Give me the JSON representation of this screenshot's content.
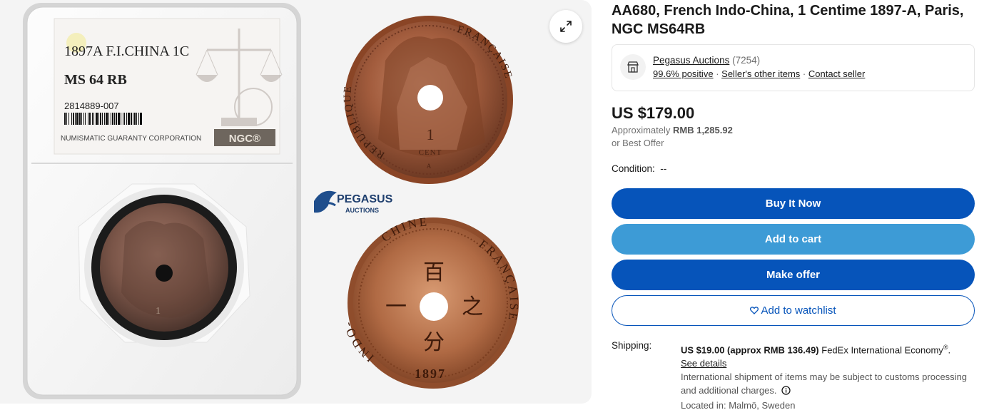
{
  "gallery": {
    "slab": {
      "label_line1": "1897A F.I.CHINA 1C",
      "grade": "MS 64 RB",
      "cert_number": "2814889-007",
      "grader_name": "NUMISMATIC GUARANTY CORPORATION",
      "grader_logo": "NGC®"
    },
    "obverse": {
      "legend_left": "REPUBLIQUE",
      "legend_right": "FRANÇAISE",
      "denomination": "1",
      "denomination_word": "CENT",
      "mint_mark": "A"
    },
    "reverse": {
      "legend_left": "INDO-",
      "legend_top": "CHINE",
      "legend_right": "FRANÇAISE",
      "char_top": "百",
      "char_left": "一",
      "char_right": "之",
      "char_bottom": "分",
      "year": "1897"
    },
    "watermark": {
      "name": "PEGASUS",
      "sub": "AUCTIONS"
    },
    "expand_icon": "expand-arrows-icon"
  },
  "listing": {
    "title": "AA680, French Indo-China, 1 Centime 1897-A, Paris, NGC MS64RB",
    "seller": {
      "name": "Pegasus Auctions",
      "feedback_count": "(7254)",
      "positive": "99.6% positive",
      "other_items": "Seller's other items",
      "contact": "Contact seller",
      "sep": "·"
    },
    "price": "US $179.00",
    "approx_prefix": "Approximately",
    "approx_value": "RMB 1,285.92",
    "best_offer": "or Best Offer",
    "condition": "Condition:  --",
    "buttons": {
      "buy": "Buy It Now",
      "cart": "Add to cart",
      "offer": "Make offer",
      "watch": "Add to watchlist"
    },
    "shipping": {
      "label": "Shipping:",
      "cost": "US $19.00 (approx RMB 136.49)",
      "service": "FedEx International Economy",
      "service_mark": "®",
      "see_details": "See details",
      "note": "International shipment of items may be subject to customs processing and additional charges.",
      "location": "Located in: Malmö, Sweden"
    }
  },
  "colors": {
    "primary_blue": "#0654ba",
    "cart_blue": "#3d9bd6",
    "copper": "#9a5532"
  }
}
